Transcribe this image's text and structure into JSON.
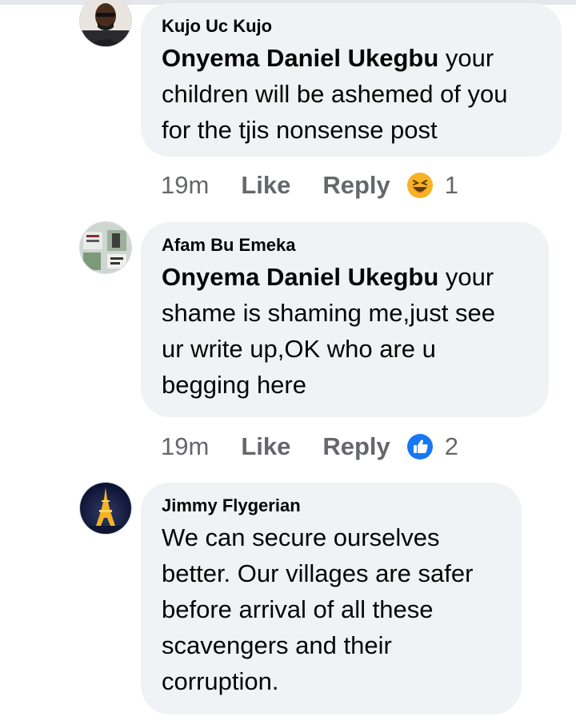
{
  "comments": [
    {
      "author": "Kujo Uc Kujo",
      "mention": "Onyema Daniel Ukegbu",
      "text": " your\nchildren will be ashemed of you\nfor the tjis nonsense post",
      "time": "19m",
      "like_label": "Like",
      "reply_label": "Reply",
      "reaction": {
        "icon": "haha-reaction-icon",
        "color": "#f7b125",
        "count": "1"
      }
    },
    {
      "author": "Afam Bu Emeka",
      "mention": "Onyema Daniel Ukegbu",
      "text": " your\nshame is shaming me,just see\nur write up,OK who are u\nbegging here",
      "time": "19m",
      "like_label": "Like",
      "reply_label": "Reply",
      "reaction": {
        "icon": "like-reaction-icon",
        "color": "#1877f2",
        "count": "2"
      }
    },
    {
      "author": "Jimmy Flygerian",
      "mention": "",
      "text": "We can secure ourselves\nbetter. Our villages are safer\nbefore arrival of all these\nscavengers and their\ncorruption."
    }
  ]
}
